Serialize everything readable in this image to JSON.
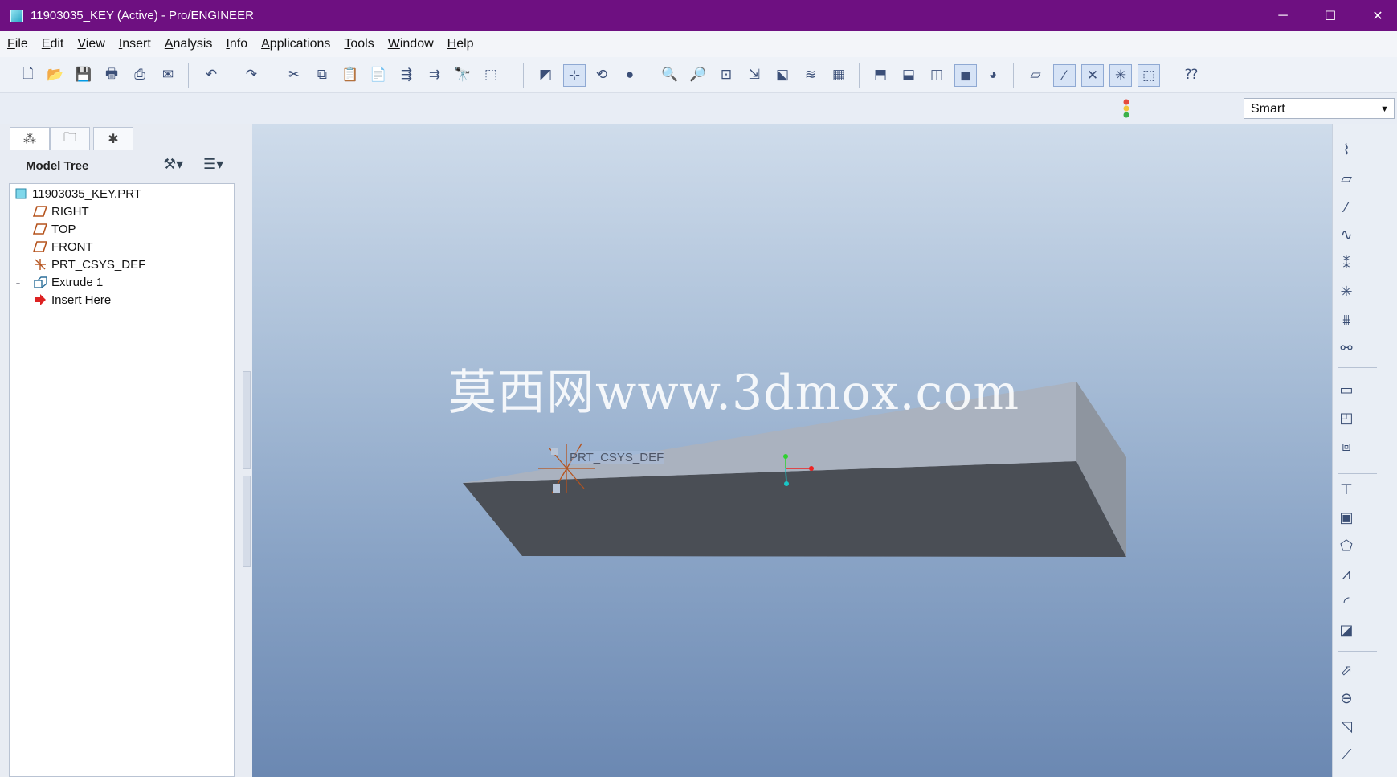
{
  "window": {
    "title": "11903035_KEY (Active) - Pro/ENGINEER",
    "controls": {
      "minimize": "─",
      "maximize": "☐",
      "close": "✕"
    }
  },
  "menu": [
    {
      "label": "File",
      "key": "F"
    },
    {
      "label": "Edit",
      "key": "E"
    },
    {
      "label": "View",
      "key": "V"
    },
    {
      "label": "Insert",
      "key": "I"
    },
    {
      "label": "Analysis",
      "key": "A"
    },
    {
      "label": "Info",
      "key": "I"
    },
    {
      "label": "Applications",
      "key": "A"
    },
    {
      "label": "Tools",
      "key": "T"
    },
    {
      "label": "Window",
      "key": "W"
    },
    {
      "label": "Help",
      "key": "H"
    }
  ],
  "toolbar": {
    "icons": [
      "new-file-icon",
      "open-file-icon",
      "save-icon",
      "print-icon",
      "print-preview-icon",
      "email-icon",
      "undo-icon",
      "redo-icon",
      "cut-icon",
      "copy-icon",
      "paste-icon",
      "paste-special-icon",
      "regenerate-icon",
      "regen-manager-icon",
      "find-icon",
      "select-box-icon",
      "repaint-icon",
      "spin-center-icon",
      "orient-mode-icon",
      "shading-icon",
      "zoom-in-icon",
      "zoom-out-icon",
      "refit-icon",
      "reorient-icon",
      "saved-views-icon",
      "layers-icon",
      "view-manager-icon",
      "wireframe-icon",
      "hidden-line-icon",
      "no-hidden-icon",
      "shaded-icon",
      "appearance-icon",
      "datum-planes-icon",
      "datum-axes-icon",
      "datum-points-icon",
      "csys-display-icon",
      "annotation-display-icon",
      "whats-this-icon"
    ]
  },
  "filter": {
    "selected": "Smart"
  },
  "panel": {
    "tabs": [
      "model-tree-tab-icon",
      "folder-browser-tab-icon",
      "favorites-tab-icon"
    ],
    "title": "Model Tree",
    "tree": [
      {
        "label": "11903035_KEY.PRT",
        "icon": "part-icon"
      },
      {
        "label": "RIGHT",
        "icon": "datum-plane-icon"
      },
      {
        "label": "TOP",
        "icon": "datum-plane-icon"
      },
      {
        "label": "FRONT",
        "icon": "datum-plane-icon"
      },
      {
        "label": "PRT_CSYS_DEF",
        "icon": "csys-icon"
      },
      {
        "label": "Extrude 1",
        "icon": "extrude-icon"
      },
      {
        "label": "Insert Here",
        "icon": "insert-arrow-icon"
      }
    ],
    "expander": "+"
  },
  "viewport": {
    "watermark": "莫西网www.3dmox.com",
    "csys_label": "PRT_CSYS_DEF",
    "colors": {
      "top_face": "#aab2bf",
      "front_face": "#4a4e55",
      "side_face": "#8e959f"
    }
  },
  "right_toolbar": {
    "icons": [
      "sketch-icon",
      "datum-plane-icon",
      "datum-axis-icon",
      "datum-curve-icon",
      "datum-point-icon",
      "csys-icon",
      "analysis-feature-icon",
      "reference-icon",
      "insert-sketch-icon",
      "style-icon",
      "shape-icon",
      "extrude-icon",
      "revolve-icon",
      "variable-sweep-icon",
      "blend-icon",
      "hole-icon",
      "shell-icon",
      "rib-icon",
      "draft-icon",
      "round-icon",
      "chamfer-icon"
    ]
  }
}
